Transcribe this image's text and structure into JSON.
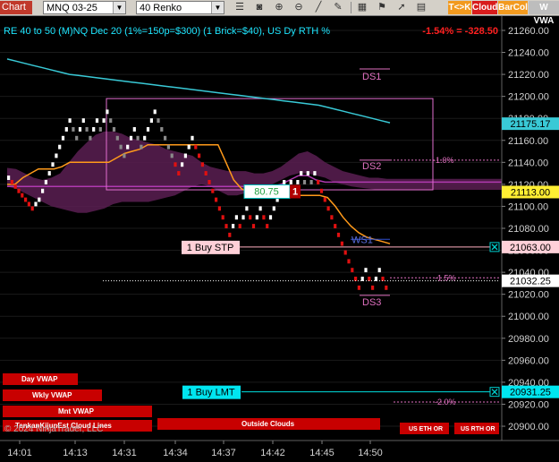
{
  "toolbar": {
    "chart_label": "Chart",
    "instrument": "MNQ 03-25",
    "bar_type": "40 Renko",
    "icons": [
      "hamburger-icon",
      "camera-icon",
      "zoom-in-icon",
      "zoom-out-icon",
      "ruler-icon",
      "pencil-icon",
      "grid-icon",
      "flag-icon",
      "arrow-icon",
      "sheet-icon"
    ],
    "tk_label": "T<>K",
    "cloud_label": "Cloud",
    "barcol_label": "BarCol",
    "wvwap_label": "W VWA"
  },
  "header": {
    "indicator_text": "RE 40 to 50 (M)NQ Dec 20 (1%=150p=$300) (1 Brick=$40), US Dy RTH %",
    "pnl_text": "-1.54% = -328.50"
  },
  "chart_data": {
    "type": "renko",
    "price_range": [
      20887,
      21273
    ],
    "y_ticks": [
      21260,
      21240,
      21220,
      21200,
      21180,
      21160,
      21140,
      21120,
      21100,
      21080,
      21060,
      21040,
      21020,
      21000,
      20980,
      20960,
      20940,
      20920,
      20900
    ],
    "x_ticks": [
      "14:01",
      "14:13",
      "14:31",
      "14:34",
      "14:37",
      "14:42",
      "14:45",
      "14:50"
    ],
    "bricks": [
      {
        "open": 21124,
        "close": 21128,
        "color": "white"
      },
      {
        "open": 21120,
        "close": 21124,
        "color": "red"
      },
      {
        "open": 21116,
        "close": 21120,
        "color": "red"
      },
      {
        "open": 21112,
        "close": 21116,
        "color": "red"
      },
      {
        "open": 21108,
        "close": 21112,
        "color": "red"
      },
      {
        "open": 21104,
        "close": 21108,
        "color": "red"
      },
      {
        "open": 21100,
        "close": 21104,
        "color": "red"
      },
      {
        "open": 21096,
        "close": 21100,
        "color": "red"
      },
      {
        "open": 21100,
        "close": 21104,
        "color": "white"
      },
      {
        "open": 21104,
        "close": 21108,
        "color": "white"
      },
      {
        "open": 21112,
        "close": 21116,
        "color": "white"
      },
      {
        "open": 21120,
        "close": 21124,
        "color": "white"
      },
      {
        "open": 21128,
        "close": 21132,
        "color": "white"
      },
      {
        "open": 21136,
        "close": 21140,
        "color": "white"
      },
      {
        "open": 21144,
        "close": 21148,
        "color": "white"
      },
      {
        "open": 21152,
        "close": 21156,
        "color": "white"
      },
      {
        "open": 21160,
        "close": 21164,
        "color": "white"
      },
      {
        "open": 21168,
        "close": 21172,
        "color": "white"
      },
      {
        "open": 21176,
        "close": 21180,
        "color": "white"
      },
      {
        "open": 21168,
        "close": 21172,
        "color": "gray"
      },
      {
        "open": 21160,
        "close": 21164,
        "color": "gray"
      },
      {
        "open": 21168,
        "close": 21172,
        "color": "white"
      },
      {
        "open": 21176,
        "close": 21180,
        "color": "white"
      },
      {
        "open": 21168,
        "close": 21172,
        "color": "gray"
      },
      {
        "open": 21160,
        "close": 21164,
        "color": "gray"
      },
      {
        "open": 21168,
        "close": 21172,
        "color": "white"
      },
      {
        "open": 21176,
        "close": 21180,
        "color": "white"
      },
      {
        "open": 21168,
        "close": 21172,
        "color": "gray"
      },
      {
        "open": 21176,
        "close": 21180,
        "color": "white"
      },
      {
        "open": 21184,
        "close": 21188,
        "color": "white"
      },
      {
        "open": 21176,
        "close": 21180,
        "color": "gray"
      },
      {
        "open": 21168,
        "close": 21172,
        "color": "gray"
      },
      {
        "open": 21160,
        "close": 21164,
        "color": "gray"
      },
      {
        "open": 21152,
        "close": 21156,
        "color": "gray"
      },
      {
        "open": 21144,
        "close": 21148,
        "color": "gray"
      },
      {
        "open": 21152,
        "close": 21156,
        "color": "white"
      },
      {
        "open": 21160,
        "close": 21164,
        "color": "white"
      },
      {
        "open": 21168,
        "close": 21172,
        "color": "white"
      },
      {
        "open": 21160,
        "close": 21164,
        "color": "gray"
      },
      {
        "open": 21152,
        "close": 21156,
        "color": "gray"
      },
      {
        "open": 21160,
        "close": 21164,
        "color": "white"
      },
      {
        "open": 21168,
        "close": 21172,
        "color": "white"
      },
      {
        "open": 21176,
        "close": 21180,
        "color": "white"
      },
      {
        "open": 21184,
        "close": 21188,
        "color": "white"
      },
      {
        "open": 21176,
        "close": 21180,
        "color": "gray"
      },
      {
        "open": 21168,
        "close": 21172,
        "color": "gray"
      },
      {
        "open": 21160,
        "close": 21164,
        "color": "gray"
      },
      {
        "open": 21152,
        "close": 21156,
        "color": "gray"
      },
      {
        "open": 21144,
        "close": 21148,
        "color": "gray"
      },
      {
        "open": 21136,
        "close": 21140,
        "color": "red"
      },
      {
        "open": 21128,
        "close": 21132,
        "color": "red"
      },
      {
        "open": 21136,
        "close": 21140,
        "color": "white"
      },
      {
        "open": 21144,
        "close": 21148,
        "color": "white"
      },
      {
        "open": 21152,
        "close": 21156,
        "color": "white"
      },
      {
        "open": 21160,
        "close": 21164,
        "color": "white"
      },
      {
        "open": 21152,
        "close": 21156,
        "color": "red"
      },
      {
        "open": 21144,
        "close": 21148,
        "color": "red"
      },
      {
        "open": 21136,
        "close": 21140,
        "color": "red"
      },
      {
        "open": 21128,
        "close": 21132,
        "color": "red"
      },
      {
        "open": 21120,
        "close": 21124,
        "color": "red"
      },
      {
        "open": 21112,
        "close": 21116,
        "color": "red"
      },
      {
        "open": 21104,
        "close": 21108,
        "color": "red"
      },
      {
        "open": 21096,
        "close": 21100,
        "color": "red"
      },
      {
        "open": 21088,
        "close": 21092,
        "color": "red"
      },
      {
        "open": 21080,
        "close": 21084,
        "color": "red"
      },
      {
        "open": 21072,
        "close": 21076,
        "color": "red"
      },
      {
        "open": 21080,
        "close": 21084,
        "color": "white"
      },
      {
        "open": 21088,
        "close": 21092,
        "color": "white"
      },
      {
        "open": 21080,
        "close": 21084,
        "color": "red"
      },
      {
        "open": 21088,
        "close": 21092,
        "color": "white"
      },
      {
        "open": 21096,
        "close": 21100,
        "color": "white"
      },
      {
        "open": 21088,
        "close": 21092,
        "color": "red"
      },
      {
        "open": 21080,
        "close": 21084,
        "color": "red"
      },
      {
        "open": 21088,
        "close": 21092,
        "color": "white"
      },
      {
        "open": 21096,
        "close": 21100,
        "color": "white"
      },
      {
        "open": 21088,
        "close": 21092,
        "color": "red"
      },
      {
        "open": 21080,
        "close": 21084,
        "color": "red"
      },
      {
        "open": 21088,
        "close": 21092,
        "color": "white"
      },
      {
        "open": 21096,
        "close": 21100,
        "color": "white"
      },
      {
        "open": 21104,
        "close": 21108,
        "color": "white"
      },
      {
        "open": 21112,
        "close": 21116,
        "color": "white"
      },
      {
        "open": 21120,
        "close": 21124,
        "color": "white"
      },
      {
        "open": 21112,
        "close": 21116,
        "color": "red"
      },
      {
        "open": 21120,
        "close": 21124,
        "color": "white"
      },
      {
        "open": 21112,
        "close": 21116,
        "color": "red"
      },
      {
        "open": 21120,
        "close": 21124,
        "color": "white"
      },
      {
        "open": 21128,
        "close": 21132,
        "color": "white"
      },
      {
        "open": 21120,
        "close": 21124,
        "color": "gray"
      },
      {
        "open": 21128,
        "close": 21132,
        "color": "white"
      },
      {
        "open": 21120,
        "close": 21124,
        "color": "gray"
      },
      {
        "open": 21128,
        "close": 21132,
        "color": "white"
      },
      {
        "open": 21120,
        "close": 21124,
        "color": "red"
      },
      {
        "open": 21112,
        "close": 21116,
        "color": "red"
      },
      {
        "open": 21104,
        "close": 21108,
        "color": "red"
      },
      {
        "open": 21096,
        "close": 21100,
        "color": "red"
      },
      {
        "open": 21088,
        "close": 21092,
        "color": "red"
      },
      {
        "open": 21080,
        "close": 21084,
        "color": "red"
      },
      {
        "open": 21072,
        "close": 21076,
        "color": "red"
      },
      {
        "open": 21064,
        "close": 21068,
        "color": "red"
      },
      {
        "open": 21056,
        "close": 21060,
        "color": "red"
      },
      {
        "open": 21048,
        "close": 21052,
        "color": "red"
      },
      {
        "open": 21040,
        "close": 21044,
        "color": "red"
      },
      {
        "open": 21032,
        "close": 21036,
        "color": "red"
      },
      {
        "open": 21024,
        "close": 21028,
        "color": "red"
      },
      {
        "open": 21032,
        "close": 21036,
        "color": "white"
      },
      {
        "open": 21040,
        "close": 21044,
        "color": "white"
      },
      {
        "open": 21032,
        "close": 21036,
        "color": "red"
      },
      {
        "open": 21024,
        "close": 21028,
        "color": "red"
      },
      {
        "open": 21032,
        "close": 21036,
        "color": "white"
      },
      {
        "open": 21040,
        "close": 21044,
        "color": "white"
      },
      {
        "open": 21032,
        "close": 21036,
        "color": "red"
      },
      {
        "open": 21024,
        "close": 21028,
        "color": "red"
      }
    ],
    "cyan_line": [
      21234,
      21232,
      21230,
      21228,
      21226,
      21224,
      21222,
      21220,
      21219,
      21218,
      21217,
      21216,
      21215,
      21214,
      21213,
      21212,
      21211,
      21210,
      21209,
      21208,
      21207,
      21206,
      21205,
      21204,
      21203,
      21202,
      21201,
      21200,
      21199,
      21198,
      21197,
      21196,
      21195,
      21194,
      21193,
      21192,
      21190,
      21188,
      21186,
      21184,
      21182,
      21180,
      21178,
      21176
    ],
    "orange_line": [
      21120,
      21120,
      21126,
      21130,
      21134,
      21134,
      21134,
      21136,
      21140,
      21140,
      21140,
      21140,
      21140,
      21140,
      21144,
      21148,
      21150,
      21152,
      21156,
      21156,
      21156,
      21156,
      21156,
      21156,
      21156,
      21156,
      21156,
      21156,
      21140,
      21124,
      21116,
      21112,
      21110,
      21110,
      21110,
      21110,
      21110,
      21110,
      21110,
      21110,
      21110,
      21108,
      21100,
      21090,
      21082,
      21076,
      21072,
      21070,
      21068,
      21066
    ],
    "cloud_upper": [
      21135,
      21134,
      21130,
      21126,
      21124,
      21126,
      21130,
      21140,
      21150,
      21158,
      21165,
      21168,
      21168,
      21166,
      21162,
      21160,
      21158,
      21156,
      21152,
      21150,
      21148,
      21146,
      21140,
      21136,
      21134,
      21132,
      21132,
      21132,
      21130,
      21130,
      21132,
      21136,
      21142,
      21148,
      21150,
      21146,
      21140,
      21136,
      21132,
      21130,
      21128,
      21126,
      21126,
      21125,
      21125,
      21125,
      21125,
      21125,
      21125,
      21125,
      21125,
      21125,
      21125,
      21125,
      21125,
      21125,
      21125
    ],
    "cloud_lower": [
      21118,
      21116,
      21112,
      21108,
      21104,
      21100,
      21098,
      21096,
      21094,
      21094,
      21096,
      21098,
      21102,
      21104,
      21104,
      21104,
      21104,
      21106,
      21108,
      21110,
      21114,
      21118,
      21120,
      21118,
      21114,
      21110,
      21110,
      21112,
      21114,
      21116,
      21120,
      21124,
      21128,
      21130,
      21130,
      21128,
      21126,
      21122,
      21120,
      21118,
      21117,
      21116,
      21115,
      21115,
      21115,
      21115,
      21115,
      21115,
      21115,
      21115,
      21115,
      21115,
      21115,
      21115,
      21115,
      21115,
      21115
    ],
    "magenta_line": [
      21118,
      21118,
      21118,
      21118,
      21118,
      21118,
      21118,
      21118,
      21118,
      21118,
      21118,
      21118,
      21118,
      21118,
      21118,
      21118,
      21118,
      21118,
      21118,
      21118,
      21118,
      21118,
      21118,
      21118,
      21118,
      21118,
      21118,
      21118,
      21118,
      21118,
      21118,
      21120,
      21124,
      21128,
      21128,
      21124,
      21122,
      21122,
      21122,
      21122,
      21122,
      21122,
      21122,
      21122,
      21122,
      21122,
      21122,
      21122,
      21122,
      21122,
      21122,
      21122,
      21122,
      21122,
      21122,
      21122,
      21122
    ],
    "levels": {
      "DS1": 21225,
      "DS2": 21142,
      "WS1": 21070,
      "DS3": 21019,
      "pct_1_0": 21142,
      "pct_1_5": 21035,
      "pct_2_0": 20922,
      "buy_stp": 21063,
      "buy_lmt": 20931.25,
      "last": 21032.25,
      "cyan_now": 21175.17,
      "marker": 21113
    },
    "box": {
      "price_top": 21198,
      "price_bottom": 21115
    }
  },
  "labels": {
    "ds1": "DS1",
    "ds2": "DS2",
    "ws1": "WS1",
    "ds3": "DS3",
    "pct_1_0": "-1.0%",
    "pct_1_5": "-1.5%",
    "pct_2_0": "-2.0%",
    "bubble_value": "80.75",
    "bubble_qty": "1",
    "buy_stp": "1 Buy STP",
    "buy_lmt": "1 Buy LMT",
    "price_cyan": "21175.17",
    "price_marker": "21113.00",
    "price_stp": "21063.00",
    "price_last": "21032.25",
    "price_lmt": "20931.25"
  },
  "bottom_buttons": {
    "day_vwap": "Day VWAP",
    "wkly_vwap": "Wkly VWAP",
    "mnt_vwap": "Mnt VWAP",
    "cloud_lines": "TenkanKijunEst Cloud Lines",
    "outside_clouds": "Outside Clouds",
    "us_eth": "US ETH OR",
    "us_rth": "US RTH OR",
    "copyright": "© 2024 NinjaTrader, LLC"
  },
  "colors": {
    "bg": "#000000",
    "cyan": "#39c9d6",
    "orange": "#ff9a1a",
    "cloud": "#5a1f52",
    "magenta": "#b03ab0",
    "pink": "#e8a0d8",
    "red_brick": "#e01010",
    "white_brick": "#ffffff",
    "gray_brick": "#8a8a8a",
    "pnl_red": "#ff2020",
    "header_text": "#1ee6ff",
    "button_red": "#c80000"
  }
}
